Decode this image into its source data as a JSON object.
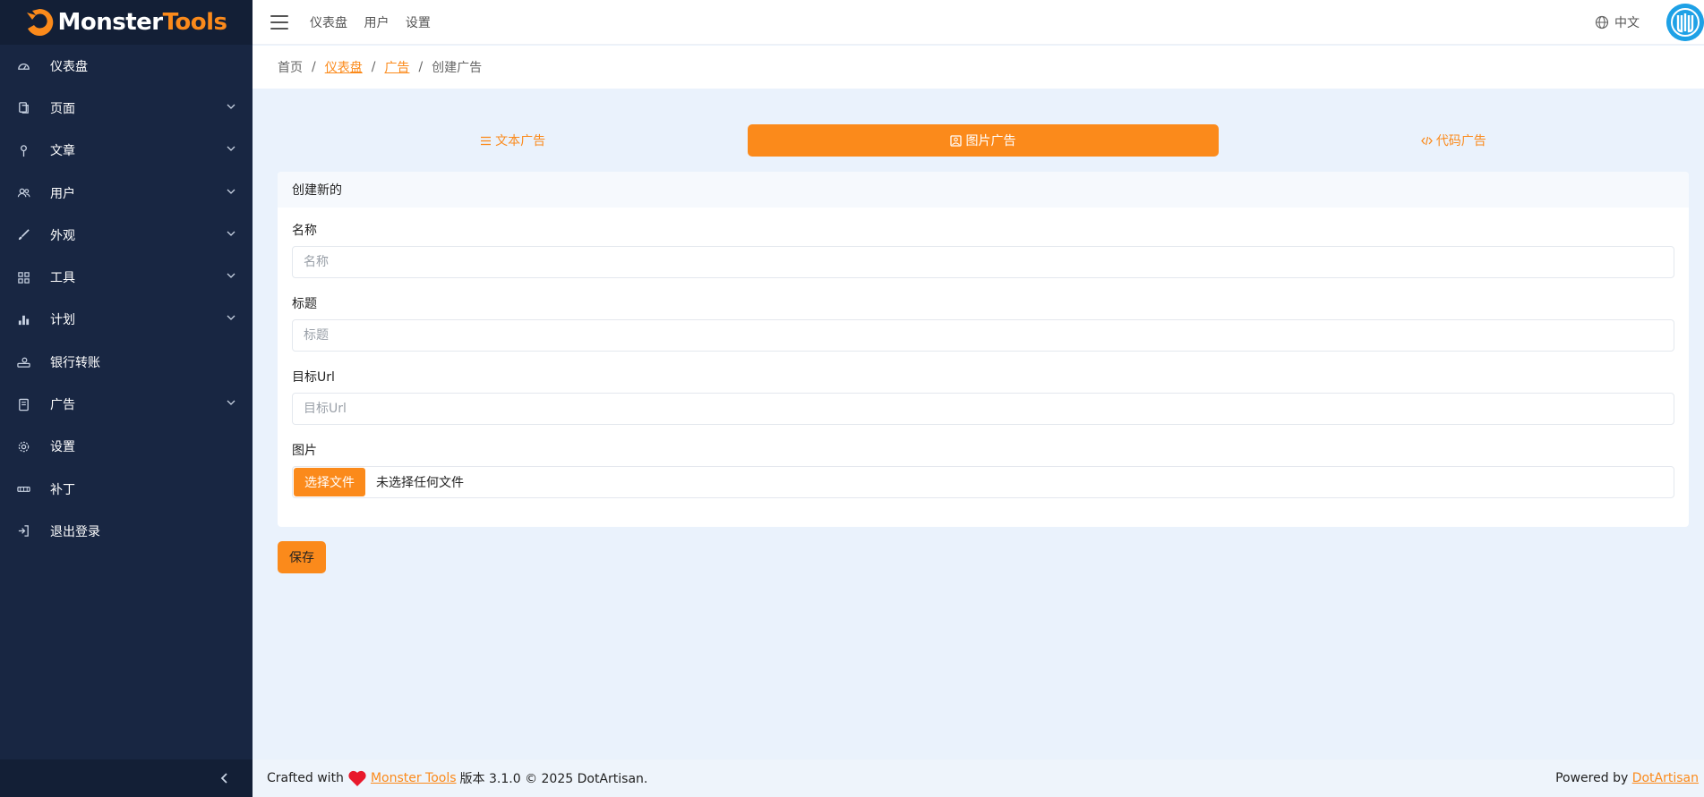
{
  "app": {
    "logo_part1": "Monster",
    "logo_part2": "Tools"
  },
  "sidebar": {
    "items": [
      {
        "label": "仪表盘",
        "icon": "dashboard-gauge-icon",
        "has_children": false
      },
      {
        "label": "页面",
        "icon": "pages-icon",
        "has_children": true
      },
      {
        "label": "文章",
        "icon": "pin-icon",
        "has_children": true
      },
      {
        "label": "用户",
        "icon": "users-icon",
        "has_children": true
      },
      {
        "label": "外观",
        "icon": "brush-icon",
        "has_children": true
      },
      {
        "label": "工具",
        "icon": "grid-icon",
        "has_children": true
      },
      {
        "label": "计划",
        "icon": "bar-chart-icon",
        "has_children": true
      },
      {
        "label": "银行转账",
        "icon": "bank-transfer-icon",
        "has_children": false
      },
      {
        "label": "广告",
        "icon": "receipt-icon",
        "has_children": true
      },
      {
        "label": "设置",
        "icon": "gear-icon",
        "has_children": false
      },
      {
        "label": "补丁",
        "icon": "patch-icon",
        "has_children": false
      },
      {
        "label": "退出登录",
        "icon": "logout-icon",
        "has_children": false
      }
    ]
  },
  "topbar": {
    "nav": [
      "仪表盘",
      "用户",
      "设置"
    ],
    "language": "中文"
  },
  "breadcrumb": {
    "items": [
      "首页",
      "仪表盘",
      "广告",
      "创建广告"
    ]
  },
  "tabs": [
    {
      "label": "文本广告",
      "active": false
    },
    {
      "label": "图片广告",
      "active": true
    },
    {
      "label": "代码广告",
      "active": false
    }
  ],
  "form": {
    "header": "创建新的",
    "name_label": "名称",
    "name_placeholder": "名称",
    "title_label": "标题",
    "title_placeholder": "标题",
    "url_label": "目标Url",
    "url_placeholder": "目标Url",
    "image_label": "图片",
    "file_button": "选择文件",
    "file_status": "未选择任何文件",
    "save_label": "保存"
  },
  "footer": {
    "crafted": "Crafted with",
    "brand_link": "Monster Tools",
    "version_text": "版本 3.1.0 © 2025 DotArtisan.",
    "powered": "Powered by",
    "powered_link": "DotArtisan"
  },
  "colors": {
    "accent": "#fb8a1b",
    "sidebar_bg": "#182642",
    "content_bg": "#eaf2fc"
  }
}
